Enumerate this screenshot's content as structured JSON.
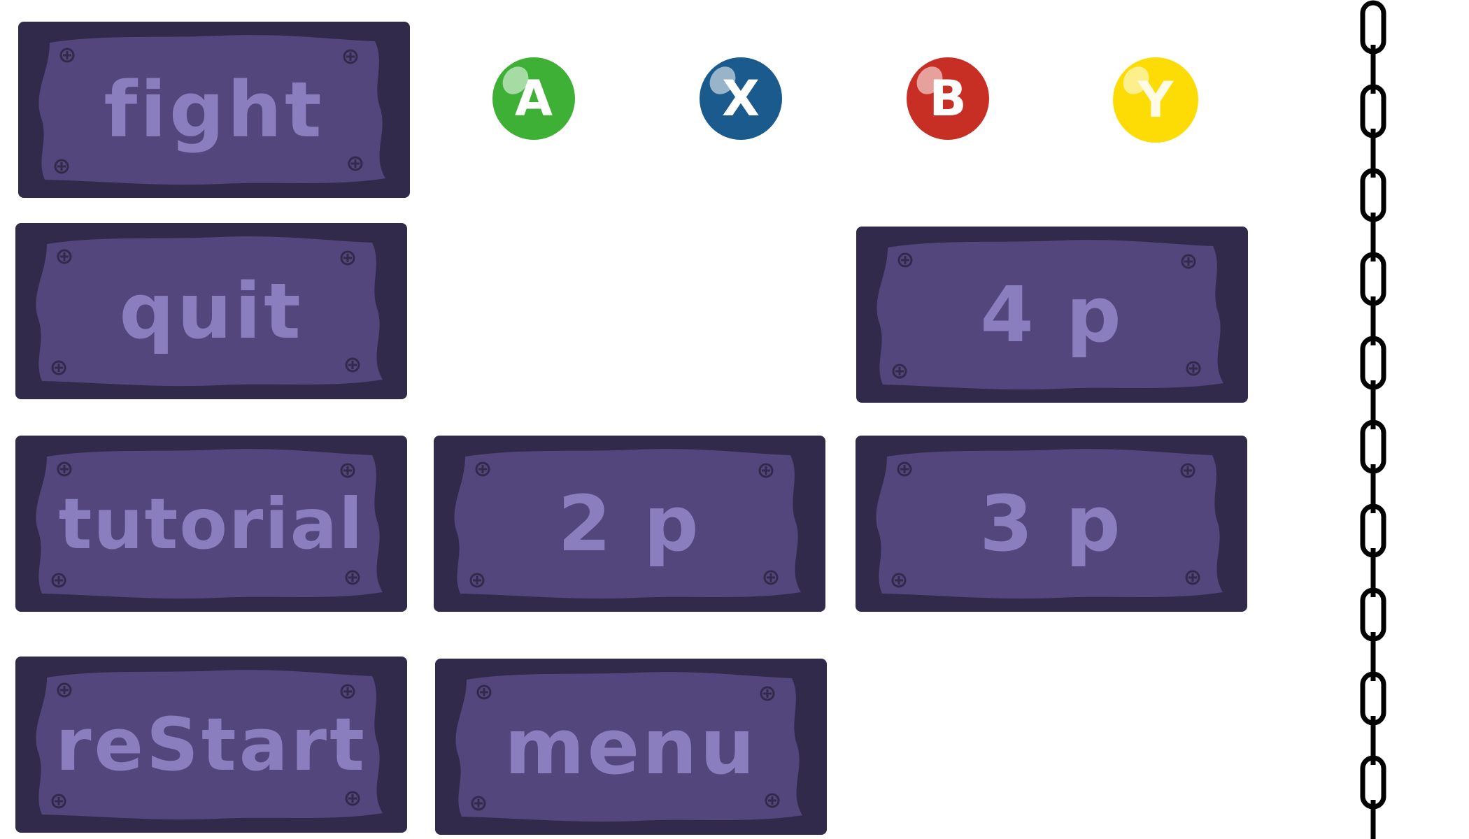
{
  "buttons": {
    "fight": "fight",
    "quit": "quit",
    "four_p": "4 p",
    "tutorial": "tutorial",
    "two_p": "2 p",
    "three_p": "3 p",
    "restart": "reStart",
    "menu": "menu"
  },
  "controller": {
    "a": "A",
    "x": "X",
    "b": "B",
    "y": "Y"
  },
  "colors": {
    "button_border": "#312a4b",
    "plate": "#52467c",
    "label": "#8b7ebf",
    "a": "#3db035",
    "x": "#1a5a8c",
    "b": "#c72f25",
    "y": "#fddb04"
  },
  "icons": {
    "screws": "screw-icon",
    "chain": "chain-icon"
  }
}
